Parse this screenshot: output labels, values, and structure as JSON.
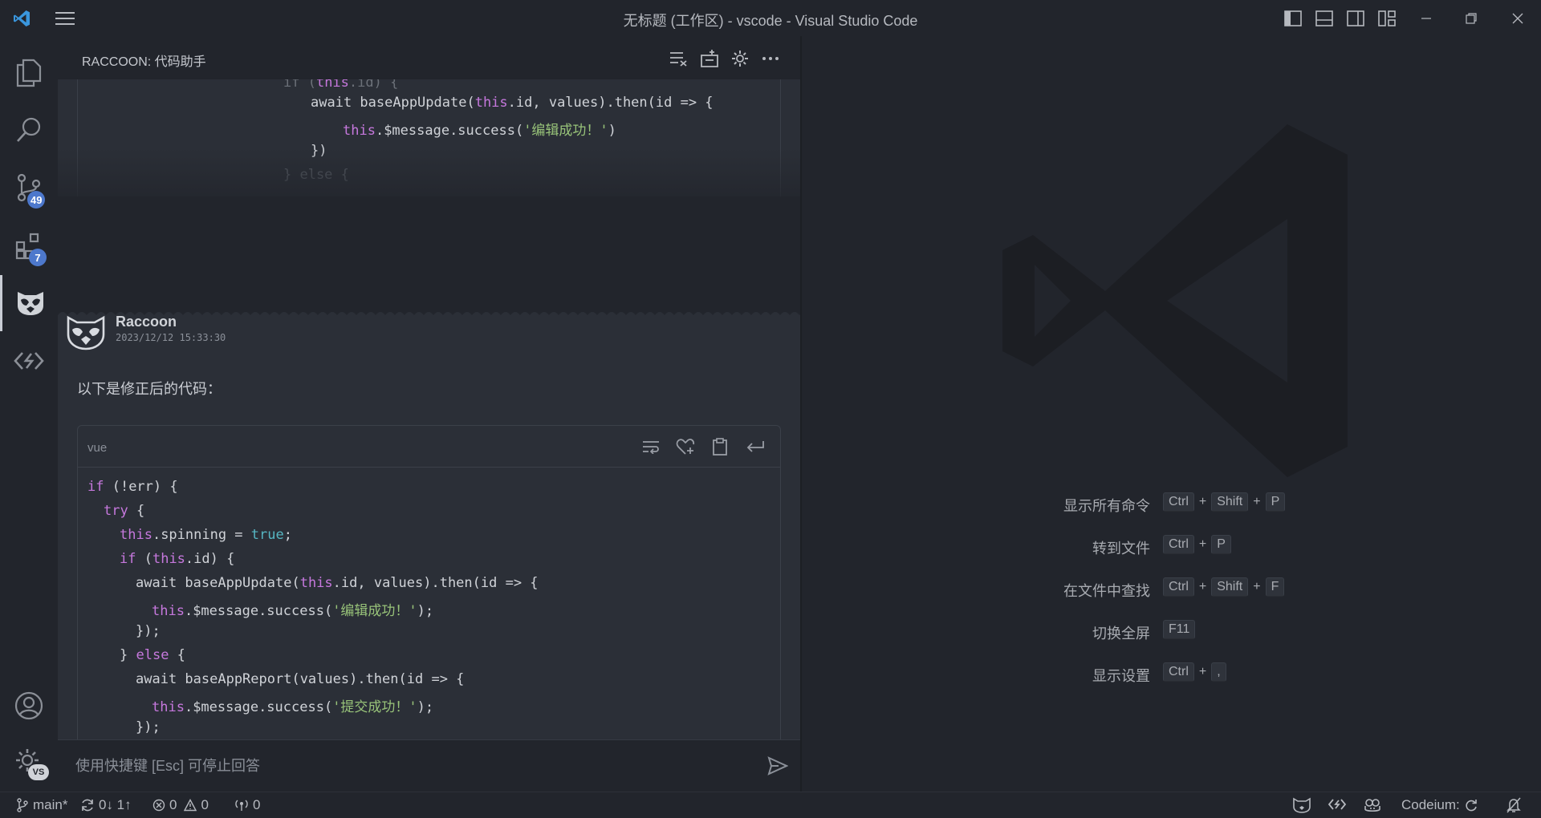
{
  "window": {
    "title": "无标题 (工作区) - vscode - Visual Studio Code"
  },
  "activity": {
    "explorer_icon": "files-icon",
    "search_icon": "search-icon",
    "scm_badge": "49",
    "extensions_badge": "7",
    "accounts_icon": "account-icon",
    "manage_badge": "VS"
  },
  "panel": {
    "title": "RACCOON: 代码助手"
  },
  "message": {
    "author": "Raccoon",
    "timestamp": "2023/12/12 15:33:30",
    "text": "以下是修正后的代码："
  },
  "code_block": {
    "language": "vue"
  },
  "input": {
    "placeholder": "使用快捷键 [Esc] 可停止回答"
  },
  "shortcuts": [
    {
      "label": "显示所有命令",
      "keys": [
        "Ctrl",
        "Shift",
        "P"
      ]
    },
    {
      "label": "转到文件",
      "keys": [
        "Ctrl",
        "P"
      ]
    },
    {
      "label": "在文件中查找",
      "keys": [
        "Ctrl",
        "Shift",
        "F"
      ]
    },
    {
      "label": "切换全屏",
      "keys": [
        "F11"
      ]
    },
    {
      "label": "显示设置",
      "keys": [
        "Ctrl",
        ","
      ]
    }
  ],
  "status": {
    "branch": "main*",
    "sync": "0↓ 1↑",
    "errors": "0",
    "warnings": "0",
    "ports": "0",
    "codeium": "Codeium:"
  },
  "colors": {
    "accent_badge": "#4d78cc",
    "keyword": "#c678dd",
    "string": "#98c379",
    "boolean": "#56b6c2"
  }
}
